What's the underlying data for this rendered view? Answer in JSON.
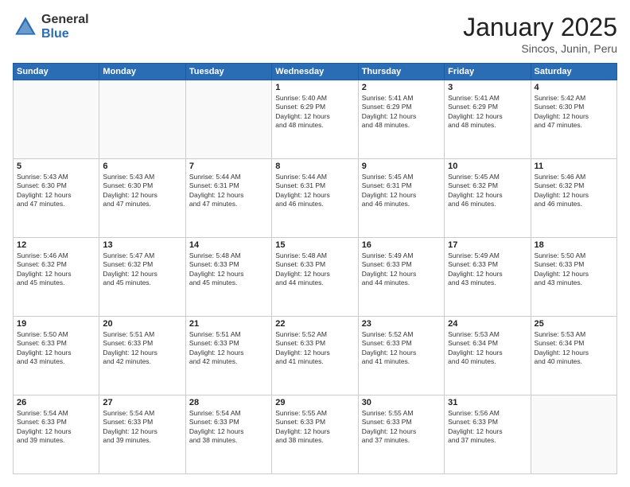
{
  "logo": {
    "general": "General",
    "blue": "Blue"
  },
  "title": "January 2025",
  "subtitle": "Sincos, Junin, Peru",
  "days_header": [
    "Sunday",
    "Monday",
    "Tuesday",
    "Wednesday",
    "Thursday",
    "Friday",
    "Saturday"
  ],
  "weeks": [
    [
      {
        "day": "",
        "detail": ""
      },
      {
        "day": "",
        "detail": ""
      },
      {
        "day": "",
        "detail": ""
      },
      {
        "day": "1",
        "detail": "Sunrise: 5:40 AM\nSunset: 6:29 PM\nDaylight: 12 hours\nand 48 minutes."
      },
      {
        "day": "2",
        "detail": "Sunrise: 5:41 AM\nSunset: 6:29 PM\nDaylight: 12 hours\nand 48 minutes."
      },
      {
        "day": "3",
        "detail": "Sunrise: 5:41 AM\nSunset: 6:29 PM\nDaylight: 12 hours\nand 48 minutes."
      },
      {
        "day": "4",
        "detail": "Sunrise: 5:42 AM\nSunset: 6:30 PM\nDaylight: 12 hours\nand 47 minutes."
      }
    ],
    [
      {
        "day": "5",
        "detail": "Sunrise: 5:43 AM\nSunset: 6:30 PM\nDaylight: 12 hours\nand 47 minutes."
      },
      {
        "day": "6",
        "detail": "Sunrise: 5:43 AM\nSunset: 6:30 PM\nDaylight: 12 hours\nand 47 minutes."
      },
      {
        "day": "7",
        "detail": "Sunrise: 5:44 AM\nSunset: 6:31 PM\nDaylight: 12 hours\nand 47 minutes."
      },
      {
        "day": "8",
        "detail": "Sunrise: 5:44 AM\nSunset: 6:31 PM\nDaylight: 12 hours\nand 46 minutes."
      },
      {
        "day": "9",
        "detail": "Sunrise: 5:45 AM\nSunset: 6:31 PM\nDaylight: 12 hours\nand 46 minutes."
      },
      {
        "day": "10",
        "detail": "Sunrise: 5:45 AM\nSunset: 6:32 PM\nDaylight: 12 hours\nand 46 minutes."
      },
      {
        "day": "11",
        "detail": "Sunrise: 5:46 AM\nSunset: 6:32 PM\nDaylight: 12 hours\nand 46 minutes."
      }
    ],
    [
      {
        "day": "12",
        "detail": "Sunrise: 5:46 AM\nSunset: 6:32 PM\nDaylight: 12 hours\nand 45 minutes."
      },
      {
        "day": "13",
        "detail": "Sunrise: 5:47 AM\nSunset: 6:32 PM\nDaylight: 12 hours\nand 45 minutes."
      },
      {
        "day": "14",
        "detail": "Sunrise: 5:48 AM\nSunset: 6:33 PM\nDaylight: 12 hours\nand 45 minutes."
      },
      {
        "day": "15",
        "detail": "Sunrise: 5:48 AM\nSunset: 6:33 PM\nDaylight: 12 hours\nand 44 minutes."
      },
      {
        "day": "16",
        "detail": "Sunrise: 5:49 AM\nSunset: 6:33 PM\nDaylight: 12 hours\nand 44 minutes."
      },
      {
        "day": "17",
        "detail": "Sunrise: 5:49 AM\nSunset: 6:33 PM\nDaylight: 12 hours\nand 43 minutes."
      },
      {
        "day": "18",
        "detail": "Sunrise: 5:50 AM\nSunset: 6:33 PM\nDaylight: 12 hours\nand 43 minutes."
      }
    ],
    [
      {
        "day": "19",
        "detail": "Sunrise: 5:50 AM\nSunset: 6:33 PM\nDaylight: 12 hours\nand 43 minutes."
      },
      {
        "day": "20",
        "detail": "Sunrise: 5:51 AM\nSunset: 6:33 PM\nDaylight: 12 hours\nand 42 minutes."
      },
      {
        "day": "21",
        "detail": "Sunrise: 5:51 AM\nSunset: 6:33 PM\nDaylight: 12 hours\nand 42 minutes."
      },
      {
        "day": "22",
        "detail": "Sunrise: 5:52 AM\nSunset: 6:33 PM\nDaylight: 12 hours\nand 41 minutes."
      },
      {
        "day": "23",
        "detail": "Sunrise: 5:52 AM\nSunset: 6:33 PM\nDaylight: 12 hours\nand 41 minutes."
      },
      {
        "day": "24",
        "detail": "Sunrise: 5:53 AM\nSunset: 6:34 PM\nDaylight: 12 hours\nand 40 minutes."
      },
      {
        "day": "25",
        "detail": "Sunrise: 5:53 AM\nSunset: 6:34 PM\nDaylight: 12 hours\nand 40 minutes."
      }
    ],
    [
      {
        "day": "26",
        "detail": "Sunrise: 5:54 AM\nSunset: 6:33 PM\nDaylight: 12 hours\nand 39 minutes."
      },
      {
        "day": "27",
        "detail": "Sunrise: 5:54 AM\nSunset: 6:33 PM\nDaylight: 12 hours\nand 39 minutes."
      },
      {
        "day": "28",
        "detail": "Sunrise: 5:54 AM\nSunset: 6:33 PM\nDaylight: 12 hours\nand 38 minutes."
      },
      {
        "day": "29",
        "detail": "Sunrise: 5:55 AM\nSunset: 6:33 PM\nDaylight: 12 hours\nand 38 minutes."
      },
      {
        "day": "30",
        "detail": "Sunrise: 5:55 AM\nSunset: 6:33 PM\nDaylight: 12 hours\nand 37 minutes."
      },
      {
        "day": "31",
        "detail": "Sunrise: 5:56 AM\nSunset: 6:33 PM\nDaylight: 12 hours\nand 37 minutes."
      },
      {
        "day": "",
        "detail": ""
      }
    ]
  ]
}
